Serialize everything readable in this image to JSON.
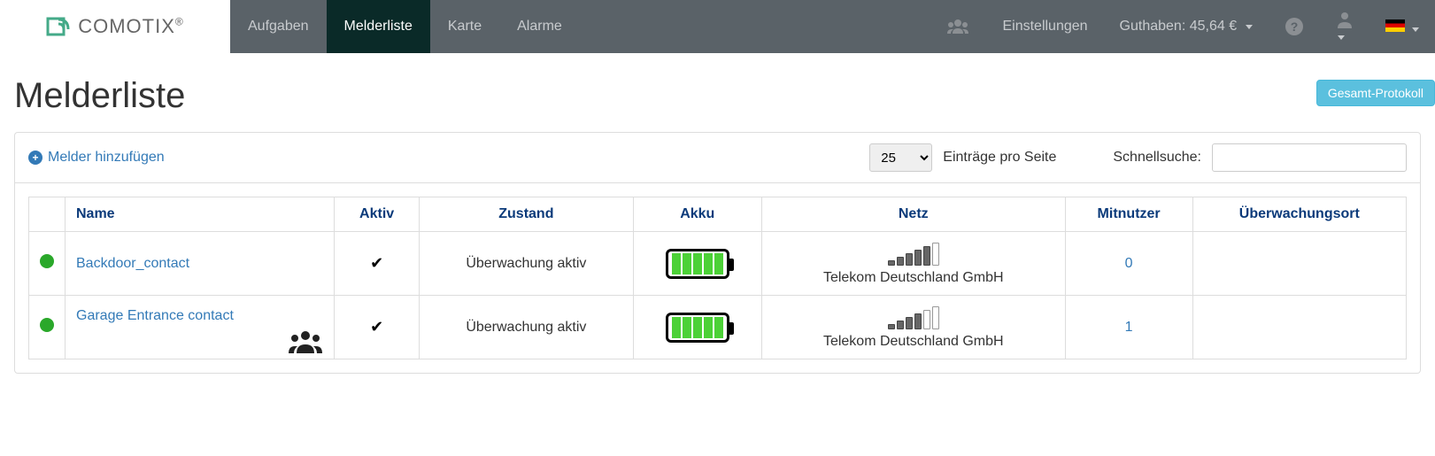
{
  "brand": {
    "name": "COMOTIX"
  },
  "nav": {
    "items": [
      {
        "label": "Aufgaben",
        "active": false
      },
      {
        "label": "Melderliste",
        "active": true
      },
      {
        "label": "Karte",
        "active": false
      },
      {
        "label": "Alarme",
        "active": false
      }
    ],
    "settings": "Einstellungen",
    "balance_label": "Guthaben: 45,64 €"
  },
  "page": {
    "title": "Melderliste",
    "protokoll_btn": "Gesamt-Protokoll",
    "add_link": "Melder hinzufügen",
    "page_size": "25",
    "per_page_label": "Einträge pro Seite",
    "search_label": "Schnellsuche:",
    "search_value": ""
  },
  "table": {
    "headers": {
      "name": "Name",
      "active": "Aktiv",
      "state": "Zustand",
      "battery": "Akku",
      "network": "Netz",
      "cousers": "Mitnutzer",
      "location": "Überwachungsort"
    },
    "rows": [
      {
        "status": "online",
        "name": "Backdoor_contact",
        "active": true,
        "state": "Überwachung aktiv",
        "battery_bars": 5,
        "signal_bars": 5,
        "signal_total": 6,
        "network": "Telekom Deutschland GmbH",
        "cousers": "0",
        "has_cousers_icon": false,
        "location": ""
      },
      {
        "status": "online",
        "name": "Garage Entrance contact",
        "active": true,
        "state": "Überwachung aktiv",
        "battery_bars": 5,
        "signal_bars": 4,
        "signal_total": 6,
        "network": "Telekom Deutschland GmbH",
        "cousers": "1",
        "has_cousers_icon": true,
        "location": ""
      }
    ]
  }
}
